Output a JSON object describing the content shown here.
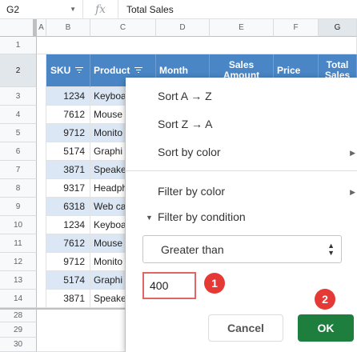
{
  "formula_bar": {
    "cell_ref": "G2",
    "fx": "fx",
    "content": "Total Sales"
  },
  "columns": [
    "A",
    "B",
    "C",
    "D",
    "E",
    "F",
    "G"
  ],
  "rows": [
    "1",
    "2",
    "3",
    "4",
    "5",
    "6",
    "7",
    "8",
    "9",
    "10",
    "11",
    "12",
    "13",
    "14",
    "28",
    "29",
    "30"
  ],
  "headers": {
    "sku": "SKU",
    "product": "Product",
    "month": "Month",
    "sales_amount": "Sales Amount",
    "price": "Price",
    "total_sales": "Total Sales"
  },
  "data_rows": [
    {
      "sku": "1234",
      "product": "Keyboa"
    },
    {
      "sku": "7612",
      "product": "Mouse"
    },
    {
      "sku": "9712",
      "product": "Monito"
    },
    {
      "sku": "5174",
      "product": "Graphi"
    },
    {
      "sku": "3871",
      "product": "Speake"
    },
    {
      "sku": "9317",
      "product": "Headph"
    },
    {
      "sku": "6318",
      "product": "Web ca"
    },
    {
      "sku": "1234",
      "product": "Keyboa"
    },
    {
      "sku": "7612",
      "product": "Mouse"
    },
    {
      "sku": "9712",
      "product": "Monito"
    },
    {
      "sku": "5174",
      "product": "Graphi"
    },
    {
      "sku": "3871",
      "product": "Speake"
    }
  ],
  "menu": {
    "sort_az": "Sort A → Z",
    "sort_za": "Sort Z → A",
    "sort_by_color": "Sort by color",
    "filter_by_color": "Filter by color",
    "filter_by_condition": "Filter by condition",
    "condition_selected": "Greater than",
    "condition_value": "400",
    "cancel_label": "Cancel",
    "ok_label": "OK",
    "badge_1": "1",
    "badge_2": "2"
  },
  "colors": {
    "header_blue": "#4a86c5",
    "row_blue": "#dbe7f4",
    "ok_green": "#1e7e3e",
    "badge_red": "#e53935"
  }
}
